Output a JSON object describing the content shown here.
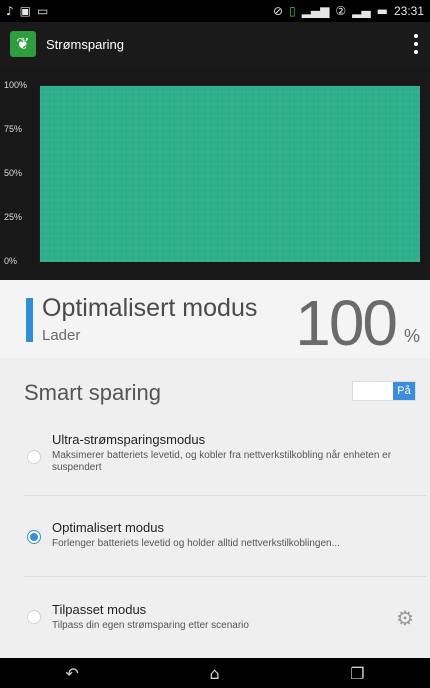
{
  "status_bar": {
    "left_icons": [
      "music-note-icon",
      "sd-card-icon",
      "image-icon"
    ],
    "right_icons": [
      "no-signal-icon",
      "sim-icon",
      "signal-bars-icon",
      "sim2-icon",
      "signal-bars-2-icon",
      "battery-charging-icon"
    ],
    "time": "23:31"
  },
  "app_bar": {
    "title": "Strømsparing",
    "logo_color": "#2e9d3f"
  },
  "chart_data": {
    "type": "area",
    "yticks": [
      "100%",
      "75%",
      "50%",
      "25%",
      "0%"
    ],
    "ylim": [
      0,
      100
    ],
    "values": [
      100,
      100
    ],
    "fill_color": "#2cae8a",
    "grid": true
  },
  "mode": {
    "name": "Optimalisert modus",
    "subtitle": "Lader",
    "percent": "100",
    "percent_sign": "%",
    "accent_color": "#2d8fd9"
  },
  "smart_saving": {
    "title": "Smart sparing",
    "toggle_label": "På",
    "toggle_on": true
  },
  "options": [
    {
      "title": "Ultra-strømsparingsmodus",
      "description": "Maksimerer batteriets levetid, og kobler fra nettverkstilkobling når enheten er suspendert",
      "selected": false
    },
    {
      "title": "Optimalisert modus",
      "description": "Forlenger batteriets levetid og holder alltid nettverkstilkoblingen...",
      "selected": true
    },
    {
      "title": "Tilpasset modus",
      "description": "Tilpass din egen strømsparing etter scenario",
      "selected": false
    }
  ],
  "nav_bar": {
    "icons": [
      "back-icon",
      "home-icon",
      "recents-icon"
    ]
  }
}
